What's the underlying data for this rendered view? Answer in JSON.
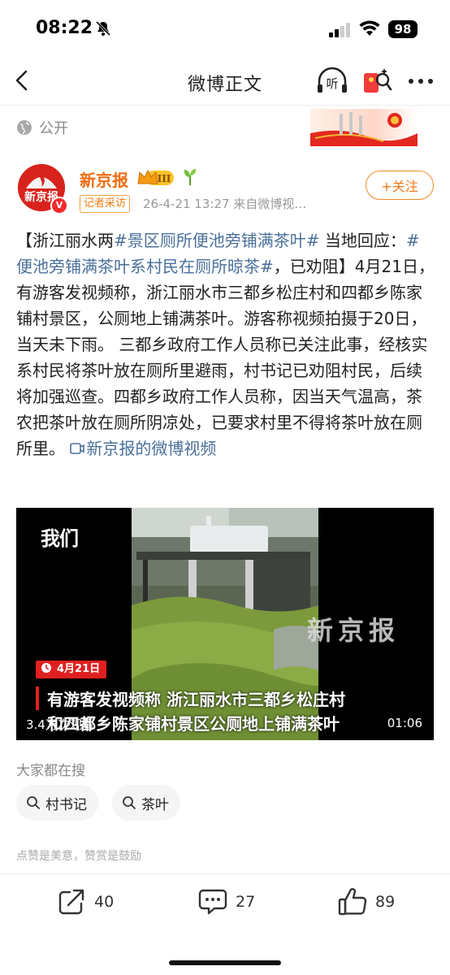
{
  "status_bar": {
    "time": "08:22",
    "battery": "98"
  },
  "nav": {
    "title": "微博正文"
  },
  "visibility": {
    "label": "公开"
  },
  "author": {
    "name": "新京报",
    "avatar_text": "新京报",
    "vip_level": "III",
    "tag": "记者采访",
    "meta": "26-4-21 13:27  来自微博视…",
    "follow_label": "+关注"
  },
  "post": {
    "p1": "【浙江丽水两",
    "tag1": "#景区厕所便池旁铺满茶叶#",
    "p2": " 当地回应：",
    "tag2": "#便池旁铺满茶叶系村民在厕所晾茶#",
    "p3": "，已劝阻】4月21日，有游客发视频称，浙江丽水市三都乡松庄村和四都乡陈家铺村景区，公厕地上铺满茶叶。游客称视频拍摄于20日，当天未下雨。 三都乡政府工作人员称已关注此事，经核实系村民将茶叶放在厕所里避雨，村书记已劝阻村民，后续将加强巡查。四都乡政府工作人员称，因当天气温高，茶农把茶叶放在厕所阴凉处，已要求村里不得将茶叶放在厕所里。 ",
    "video_link": "新京报的微博视频"
  },
  "video": {
    "logo": "我们",
    "watermark": "新京报",
    "date_badge": "4月21日",
    "caption_line1": "有游客发视频称 浙江丽水市三都乡松庄村",
    "caption_line2": "和四都乡陈家铺村景区公厕地上铺满茶叶",
    "views": "3.4万次观看",
    "duration": "01:06"
  },
  "search": {
    "title": "大家都在搜",
    "chips": [
      "村书记",
      "茶叶"
    ]
  },
  "like_hint": "点赞是美意，赞赏是鼓励",
  "actions": {
    "share": "40",
    "comment": "27",
    "like": "89"
  }
}
